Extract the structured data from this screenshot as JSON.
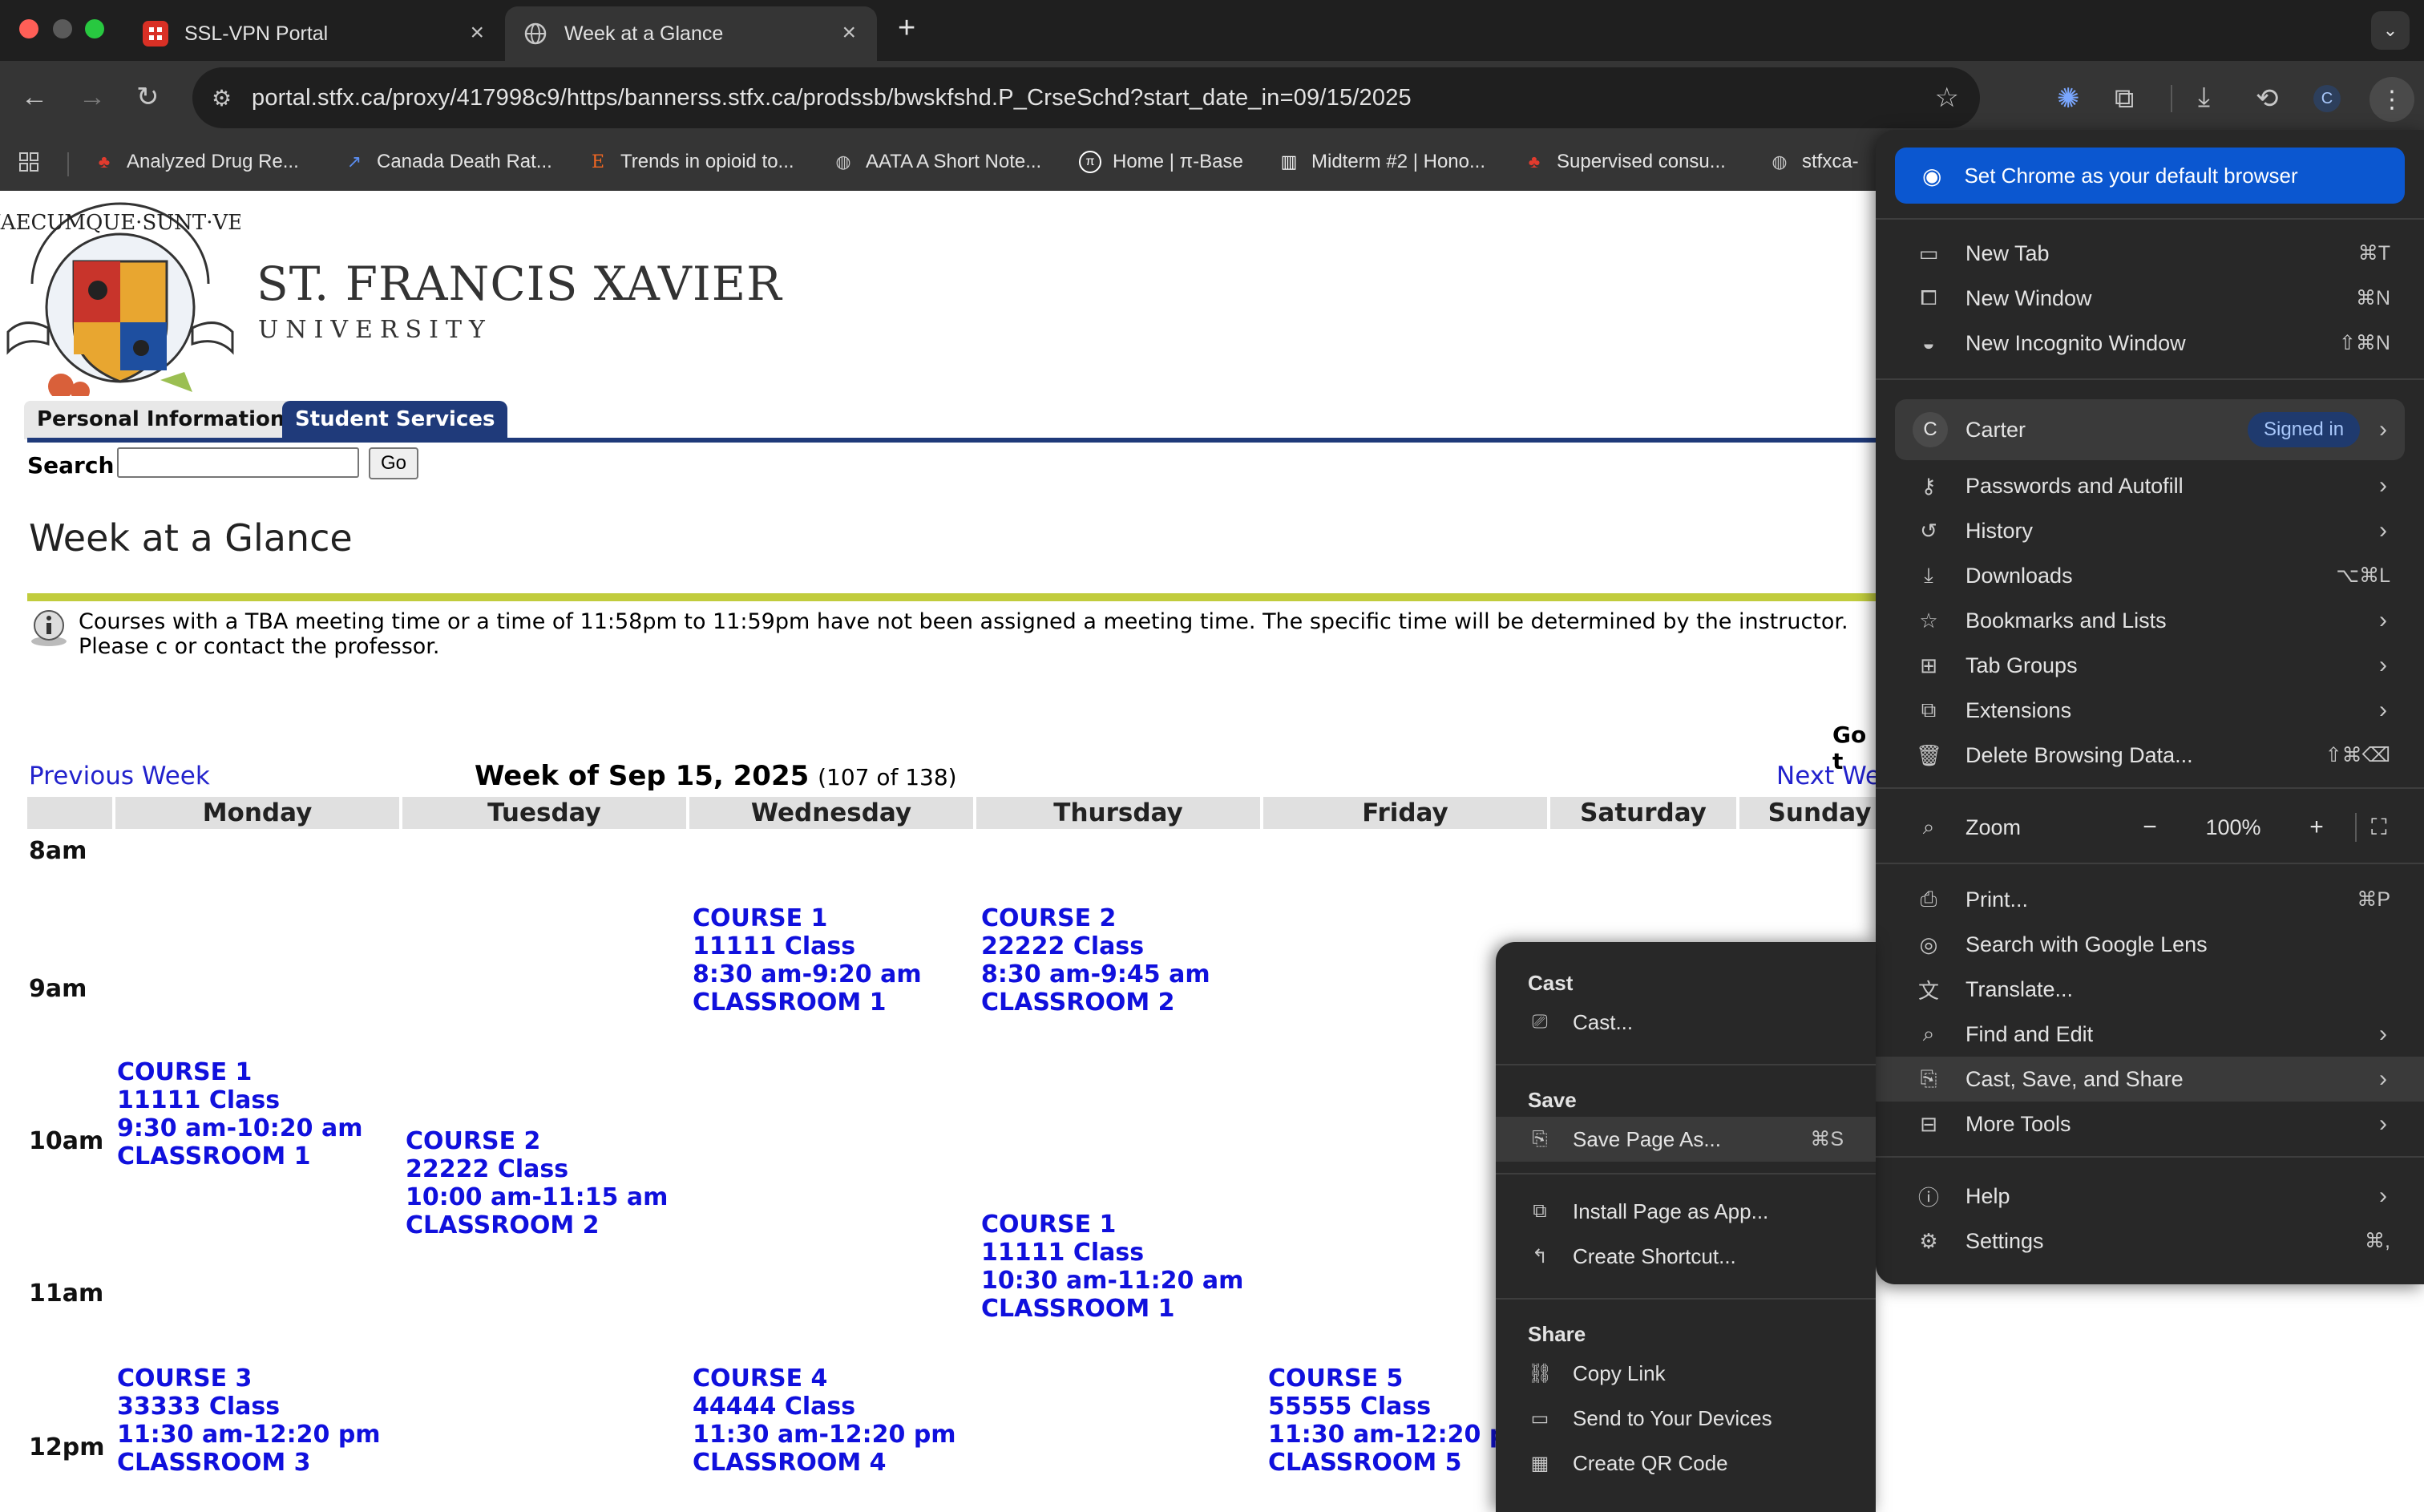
{
  "tabs": [
    {
      "title": "SSL-VPN Portal",
      "active": false
    },
    {
      "title": "Week at a Glance",
      "active": true
    }
  ],
  "address_bar": {
    "url": "portal.stfx.ca/proxy/417998c9/https/bannerss.stfx.ca/prodssb/bwskfshd.P_CrseSchd?start_date_in=09/15/2025"
  },
  "bookmarks": [
    "Analyzed Drug Re...",
    "Canada Death Rat...",
    "Trends in opioid to...",
    "AATA A Short Note...",
    "Home | π-Base",
    "Midterm #2 | Hono...",
    "Supervised consu...",
    "stfxca-"
  ],
  "university": {
    "name": "ST. FRANCIS XAVIER",
    "sub": "UNIVERSITY",
    "motto": "QUAECUMQUE·SUNT·VERA"
  },
  "nav_tabs": [
    "Personal Information",
    "Student Services"
  ],
  "search": {
    "label": "Search",
    "button": "Go",
    "value": ""
  },
  "page_title": "Week at a Glance",
  "notice": "Courses with a TBA meeting time or a time of 11:58pm to 11:59pm have not been assigned a meeting time. The specific time will be determined by the instructor. Please c or contact the professor.",
  "go_to_label": "Go t",
  "week_nav": {
    "previous": "Previous Week",
    "week_of": "Week of Sep 15, 2025",
    "count": "(107 of 138)",
    "next": "Next We"
  },
  "days": [
    "Monday",
    "Tuesday",
    "Wednesday",
    "Thursday",
    "Friday",
    "Saturday",
    "Sunday"
  ],
  "hours": [
    "8am",
    "9am",
    "10am",
    "11am",
    "12pm"
  ],
  "courses": [
    {
      "lines": [
        "COURSE 1",
        "11111 Class",
        "8:30 am-9:20 am",
        "CLASSROOM 1"
      ]
    },
    {
      "lines": [
        "COURSE 2",
        "22222 Class",
        "8:30 am-9:45 am",
        "CLASSROOM 2"
      ]
    },
    {
      "lines": [
        "COURSE 1",
        "11111 Class",
        "9:30 am-10:20 am",
        "CLASSROOM 1"
      ]
    },
    {
      "lines": [
        "COURSE 2",
        "22222 Class",
        "10:00 am-11:15 am",
        "CLASSROOM 2"
      ]
    },
    {
      "lines": [
        "COURSE 1",
        "11111 Class",
        "10:30 am-11:20 am",
        "CLASSROOM 1"
      ]
    },
    {
      "lines": [
        "COURSE 3",
        "33333 Class",
        "11:30 am-12:20 pm",
        "CLASSROOM 3"
      ]
    },
    {
      "lines": [
        "COURSE 4",
        "44444 Class",
        "11:30 am-12:20 pm",
        "CLASSROOM 4"
      ]
    },
    {
      "lines": [
        "COURSE 5",
        "55555 Class",
        "11:30 am-12:20 p",
        "CLASSROOM 5"
      ]
    }
  ],
  "chrome_menu": {
    "default_browser": "Set Chrome as your default browser",
    "new_tab": {
      "label": "New Tab",
      "shortcut": "⌘T"
    },
    "new_window": {
      "label": "New Window",
      "shortcut": "⌘N"
    },
    "incognito": {
      "label": "New Incognito Window",
      "shortcut": "⇧⌘N"
    },
    "profile": {
      "initial": "C",
      "name": "Carter",
      "status": "Signed in"
    },
    "passwords": "Passwords and Autofill",
    "history": "History",
    "downloads": {
      "label": "Downloads",
      "shortcut": "⌥⌘L"
    },
    "bookmarks": "Bookmarks and Lists",
    "tab_groups": "Tab Groups",
    "extensions": "Extensions",
    "delete_data": {
      "label": "Delete Browsing Data...",
      "shortcut": "⇧⌘⌫"
    },
    "zoom": {
      "label": "Zoom",
      "minus": "−",
      "value": "100%",
      "plus": "+"
    },
    "print": {
      "label": "Print...",
      "shortcut": "⌘P"
    },
    "lens": "Search with Google Lens",
    "translate": "Translate...",
    "find_edit": "Find and Edit",
    "cast_save_share": "Cast, Save, and Share",
    "more_tools": "More Tools",
    "help": "Help",
    "settings": {
      "label": "Settings",
      "shortcut": "⌘,"
    }
  },
  "submenu": {
    "cast_header": "Cast",
    "cast": "Cast...",
    "save_header": "Save",
    "save_page": {
      "label": "Save Page As...",
      "shortcut": "⌘S"
    },
    "install_app": "Install Page as App...",
    "create_shortcut": "Create Shortcut...",
    "share_header": "Share",
    "copy_link": "Copy Link",
    "send_devices": "Send to Your Devices",
    "qr_code": "Create QR Code"
  },
  "colors": {
    "link": "#2222cc",
    "course": "#1010dd",
    "nav_line": "#1f3a7a",
    "accent_line": "#c1cc3d",
    "menu_bg": "#282828",
    "primary_btn": "#0b57d0"
  }
}
